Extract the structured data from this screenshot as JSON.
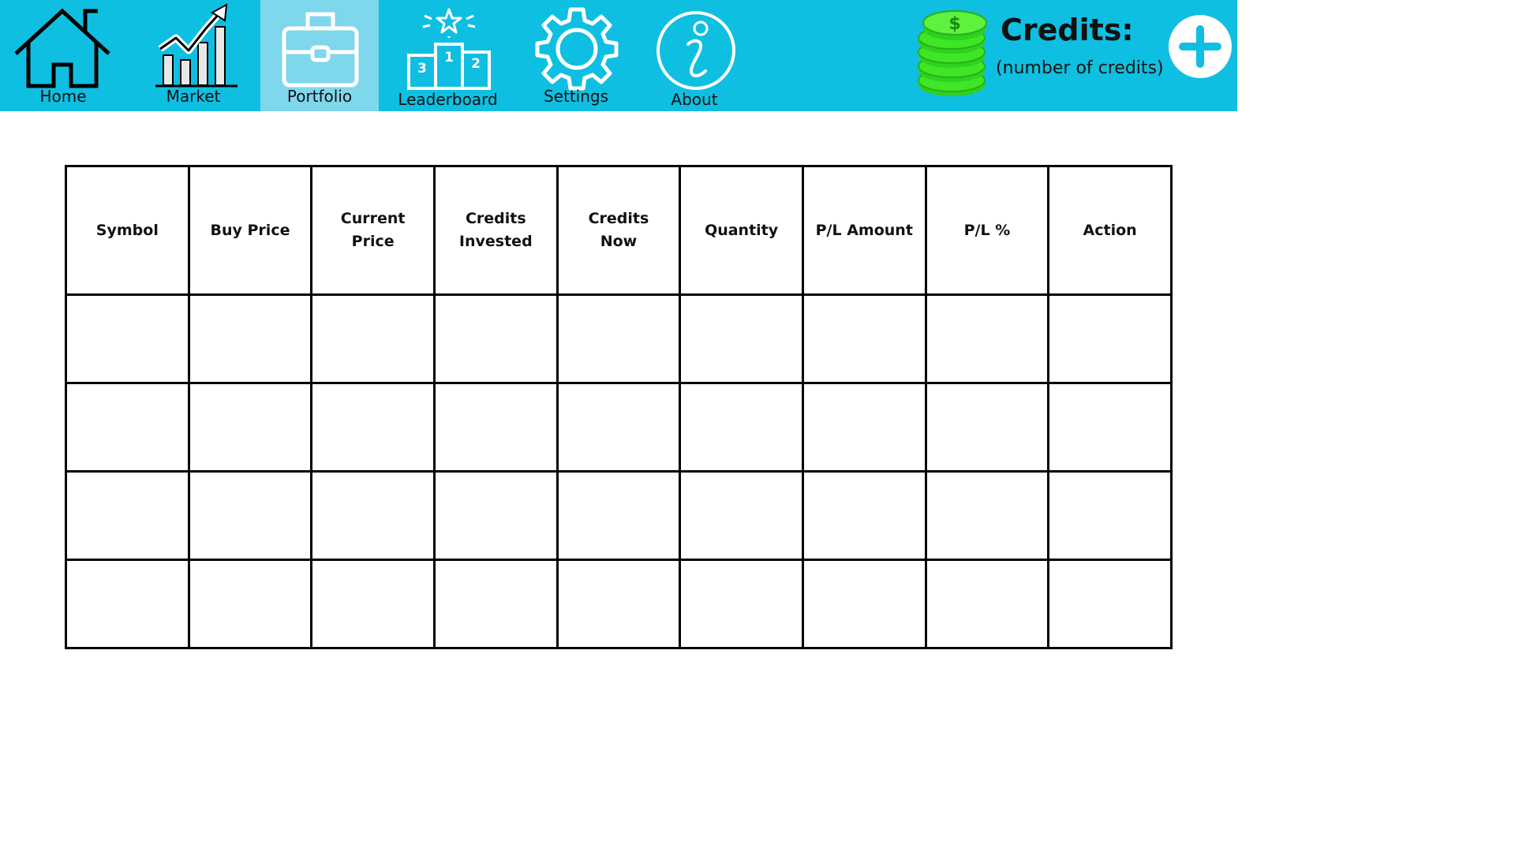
{
  "nav": {
    "items": [
      {
        "label": "Home",
        "icon": "home-icon",
        "active": false
      },
      {
        "label": "Market",
        "icon": "market-chart-icon",
        "active": false
      },
      {
        "label": "Portfolio",
        "icon": "briefcase-icon",
        "active": true
      },
      {
        "label": "Leaderboard",
        "icon": "podium-icon",
        "active": false
      },
      {
        "label": "Settings",
        "icon": "gear-icon",
        "active": false
      },
      {
        "label": "About",
        "icon": "info-icon",
        "active": false
      }
    ]
  },
  "credits": {
    "title": "Credits:",
    "value": "(number of credits)",
    "add_icon": "plus-icon",
    "coin_icon": "coin-stack-icon"
  },
  "table": {
    "columns": [
      "Symbol",
      "Buy Price",
      "Current Price",
      "Credits Invested",
      "Credits Now",
      "Quantity",
      "P/L Amount",
      "P/L %",
      "Action"
    ],
    "rows": [
      [
        "",
        "",
        "",
        "",
        "",
        "",
        "",
        "",
        ""
      ],
      [
        "",
        "",
        "",
        "",
        "",
        "",
        "",
        "",
        ""
      ],
      [
        "",
        "",
        "",
        "",
        "",
        "",
        "",
        "",
        ""
      ],
      [
        "",
        "",
        "",
        "",
        "",
        "",
        "",
        "",
        ""
      ]
    ]
  },
  "colors": {
    "navbar": "#0fbfe1",
    "active_tab": "#7fd7ec",
    "coin_green": "#3ee626"
  }
}
